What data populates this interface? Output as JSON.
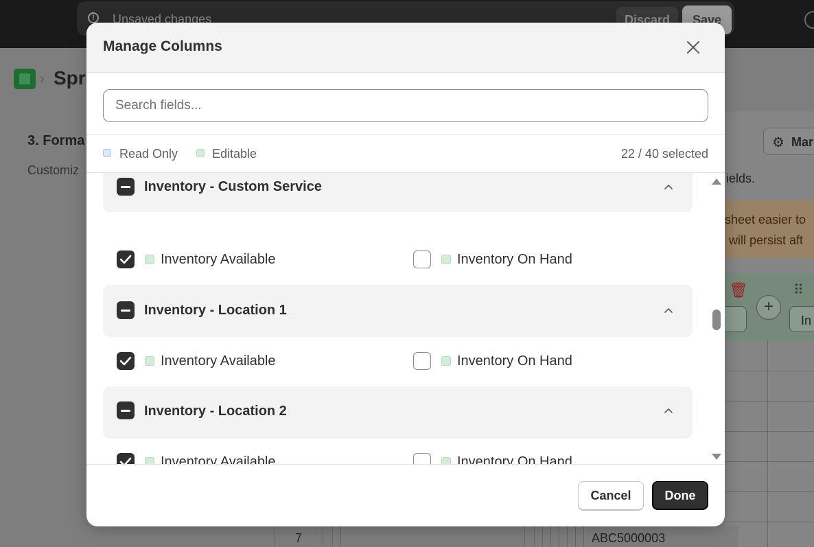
{
  "background": {
    "save_bar": {
      "message": "Unsaved changes",
      "discard_label": "Discard",
      "save_label": "Save"
    },
    "breadcrumb_title": "Spre",
    "section_title": "3. Forma",
    "section_subtitle": "Customiz",
    "manage_button_label": "Mar",
    "fields_text": "ields.",
    "banner_line_1": "sheet easier to",
    "banner_line_2": "will persist aft",
    "column_pill_text": "In",
    "table_row_number": "7",
    "table_cell_value": "ABC5000003"
  },
  "modal": {
    "title": "Manage Columns",
    "search": {
      "placeholder": "Search fields...",
      "value": ""
    },
    "legend": {
      "read_only_label": "Read Only",
      "editable_label": "Editable",
      "read_only_color": "#dbe9fb",
      "editable_color": "#d4edda"
    },
    "selected_count": "22 / 40 selected",
    "groups": [
      {
        "title": "Inventory - Custom Service",
        "state": "indeterminate",
        "expanded": true,
        "fields": [
          {
            "label": "Inventory Available",
            "checked": true,
            "type": "editable"
          },
          {
            "label": "Inventory On Hand",
            "checked": false,
            "type": "editable"
          }
        ]
      },
      {
        "title": "Inventory - Location 1",
        "state": "indeterminate",
        "expanded": true,
        "fields": [
          {
            "label": "Inventory Available",
            "checked": true,
            "type": "editable"
          },
          {
            "label": "Inventory On Hand",
            "checked": false,
            "type": "editable"
          }
        ]
      },
      {
        "title": "Inventory - Location 2",
        "state": "indeterminate",
        "expanded": true,
        "fields": [
          {
            "label": "Inventory Available",
            "checked": true,
            "type": "editable"
          },
          {
            "label": "Inventory On Hand",
            "checked": false,
            "type": "editable"
          }
        ]
      }
    ],
    "footer": {
      "cancel_label": "Cancel",
      "done_label": "Done"
    }
  },
  "colors": {
    "primary_dark": "#303030",
    "editable_swatch": "#d4edda",
    "read_only_swatch": "#dbe9fb"
  }
}
